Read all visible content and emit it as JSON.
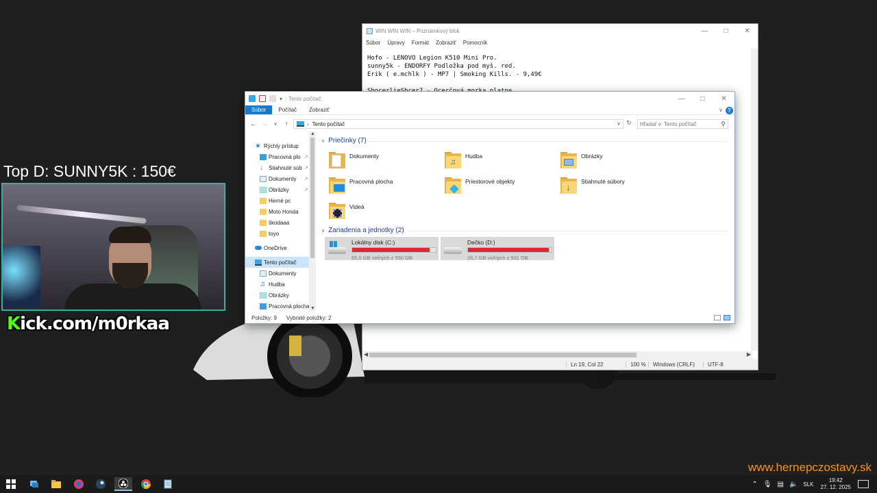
{
  "stream": {
    "top_donation": "Top D: SUNNY5K : 150€",
    "kick_k": "K",
    "kick_rest": "ick.com/m0rkaa",
    "site_url": "www.hernepczostavy.sk"
  },
  "notepad": {
    "title": "WIN WIN WIN – Poznámkový blok",
    "menu": [
      "Súbor",
      "Úpravy",
      "Formát",
      "Zobraziť",
      "Pomocník"
    ],
    "lines": [
      "Hofo - LENOVO Legion K510 Mini Pro.",
      "sunny5k - ENDORFY Podložka pod myš. red.",
      "Erik ( e.mchlk ) - MP7 | Smoking Kills. - 9,49€",
      "",
      "SbocerlieSbcer7 - Ocerčová morka platne"
    ],
    "status": {
      "position": "Ln 19, Col 22",
      "zoom": "100 %",
      "line_ending": "Windows (CRLF)",
      "encoding": "UTF-8"
    }
  },
  "explorer": {
    "title": "Tento počítač",
    "ribbon_tabs": [
      "Súbor",
      "Počítač",
      "Zobraziť"
    ],
    "help": "?",
    "address": "Tento počítač",
    "search_placeholder": "Hľadať v: Tento počítač",
    "nav": {
      "quick_access": "Rýchly prístup",
      "pinned": [
        "Pracovná plo",
        "Stiahnuté súb",
        "Dokumenty",
        "Obrázky"
      ],
      "folders": [
        "Herné pc",
        "Moto Honda",
        "škodaaa",
        "toyo"
      ],
      "onedrive": "OneDrive",
      "this_pc": "Tento počítač",
      "this_pc_children": [
        "Dokumenty",
        "Hudba",
        "Obrázky",
        "Pracovná plocha"
      ]
    },
    "folders_header": "Priečinky (7)",
    "folders": [
      "Dokumenty",
      "Hudba",
      "Obrázky",
      "Pracovná plocha",
      "Priestorové objekty",
      "Stiahnuté súbory",
      "Videá"
    ],
    "devices_header": "Zariadenia a jednotky (2)",
    "drives": [
      {
        "name": "Lokálny disk (C:)",
        "free": "65,0 GB voľných z 930 GB",
        "used_fraction": 0.93
      },
      {
        "name": "Dečko (D:)",
        "free": "26,7 GB voľných z 931 GB",
        "used_fraction": 0.97
      }
    ],
    "status_items": "Položky: 9",
    "status_selected": "Vybraté položky: 2"
  },
  "taskbar": {
    "tray_lang": "SLK",
    "time": "19:42",
    "date": "27. 12. 2025"
  },
  "colors": {
    "drive_bar": "#da2a34",
    "kick_green": "#53fc18",
    "site_orange": "#f7931e",
    "ribbon_blue": "#1979ca"
  }
}
